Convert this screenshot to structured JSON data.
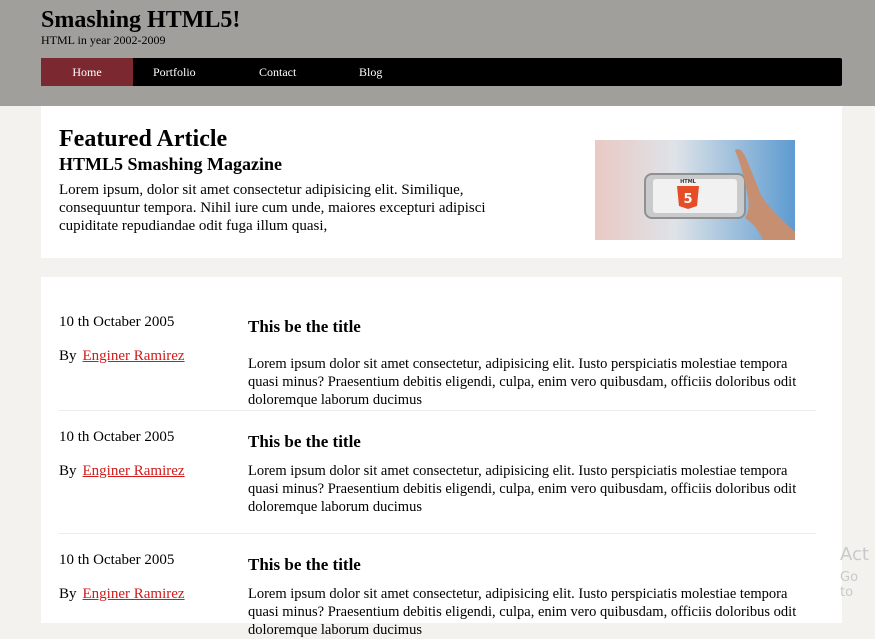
{
  "header": {
    "site_title": "Smashing HTML5!",
    "tagline": "HTML in year 2002-2009"
  },
  "nav": {
    "items": [
      {
        "label": "Home",
        "active": true
      },
      {
        "label": "Portfolio"
      },
      {
        "label": "Contact"
      },
      {
        "label": "Blog"
      }
    ]
  },
  "featured": {
    "heading": "Featured Article",
    "subheading": "HTML5 Smashing Magazine",
    "text": "Lorem ipsum, dolor sit amet consectetur adipisicing elit. Similique, consequuntur tempora. Nihil iure cum unde, maiores excepturi adipisci cupiditate repudiandae odit fuga illum quasi,",
    "image_badge": "HTML",
    "image_number": "5"
  },
  "posts": [
    {
      "date": "10 th Octaber 2005",
      "by": "By",
      "author": "Enginer Ramirez",
      "title": "This be the title",
      "body": "Lorem ipsum dolor sit amet consectetur, adipisicing elit. Iusto perspiciatis molestiae tempora quasi minus? Praesentium debitis eligendi, culpa, enim vero quibusdam, officiis doloribus odit doloremque laborum ducimus"
    },
    {
      "date": "10 th Octaber 2005",
      "by": "By",
      "author": "Enginer Ramirez",
      "title": "This be the title",
      "body": "Lorem ipsum dolor sit amet consectetur, adipisicing elit. Iusto perspiciatis molestiae tempora quasi minus? Praesentium debitis eligendi, culpa, enim vero quibusdam, officiis doloribus odit doloremque laborum ducimus"
    },
    {
      "date": "10 th Octaber 2005",
      "by": "By",
      "author": "Enginer Ramirez",
      "title": "This be the title",
      "body": "Lorem ipsum dolor sit amet consectetur, adipisicing elit. Iusto perspiciatis molestiae tempora quasi minus? Praesentium debitis eligendi, culpa, enim vero quibusdam, officiis doloribus odit doloremque laborum ducimus"
    }
  ],
  "watermark": {
    "line1": "Act",
    "line2": "Go to"
  },
  "colors": {
    "header_bg": "#a19f9c",
    "nav_bg": "#000000",
    "nav_active": "#7c2830",
    "link": "#d11a1a"
  }
}
